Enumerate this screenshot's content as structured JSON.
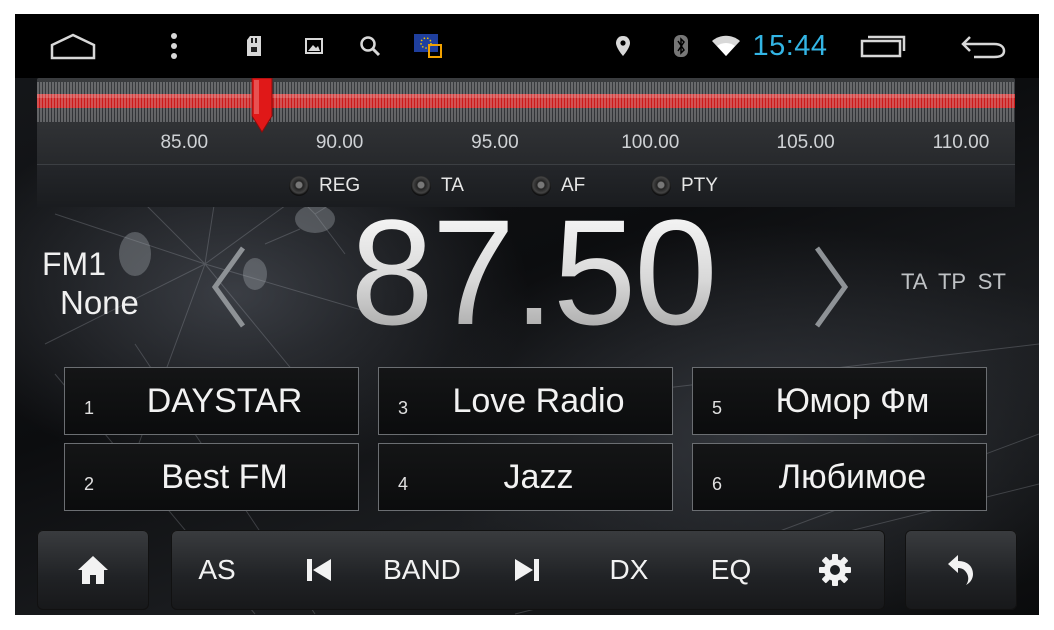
{
  "status_bar": {
    "time": "15:44",
    "icons": [
      "home-outline-icon",
      "overflow-menu-icon",
      "sd-card-icon",
      "gallery-icon",
      "search-icon",
      "eu-flag-icon",
      "location-icon",
      "bluetooth-icon",
      "wifi-icon",
      "recent-apps-icon",
      "back-icon"
    ]
  },
  "tuner": {
    "scale_labels": [
      "85.00",
      "90.00",
      "95.00",
      "100.00",
      "105.00",
      "110.00"
    ],
    "current_frequency": 87.5
  },
  "options": {
    "reg": "REG",
    "ta": "TA",
    "af": "AF",
    "pty": "PTY"
  },
  "display": {
    "band": "FM1",
    "ps_name": "None",
    "frequency": "87.50",
    "flags": "TA TP ST"
  },
  "presets": [
    {
      "num": "1",
      "name": "DAYSTAR"
    },
    {
      "num": "2",
      "name": "Best FM"
    },
    {
      "num": "3",
      "name": "Love Radio"
    },
    {
      "num": "4",
      "name": "Jazz"
    },
    {
      "num": "5",
      "name": "Юмор Фм"
    },
    {
      "num": "6",
      "name": "Любимое"
    }
  ],
  "bottom_bar": {
    "as": "AS",
    "band": "BAND",
    "dx": "DX",
    "eq": "EQ"
  },
  "colors": {
    "clock": "#33b5e5",
    "tuner_band": "#cc1a1a",
    "needle": "#e01818"
  }
}
